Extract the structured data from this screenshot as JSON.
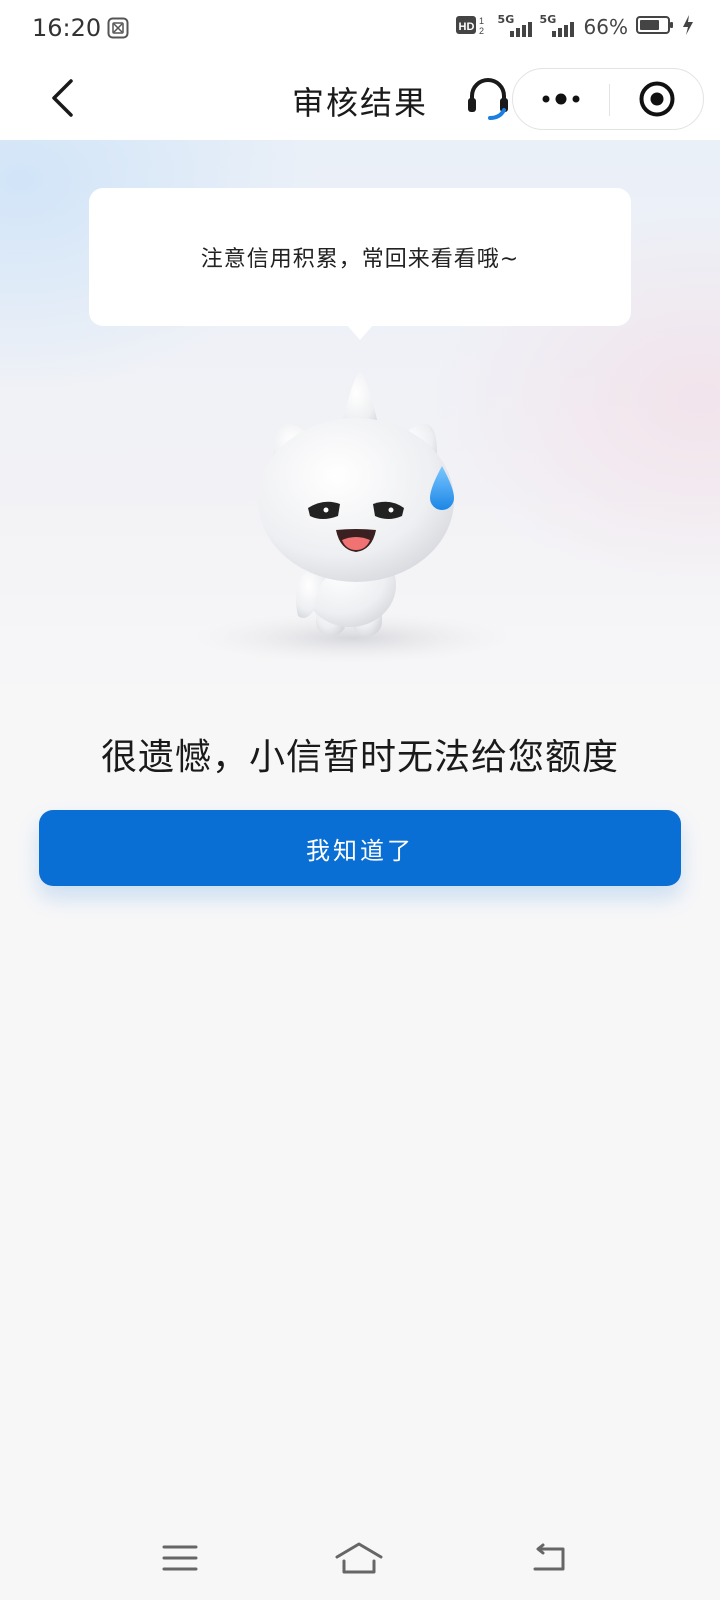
{
  "status_bar": {
    "time": "16:20",
    "battery_percent": "66%",
    "network_1": "5G",
    "network_2": "5G",
    "icons": [
      "screenshot-notification-icon",
      "hd-icon",
      "signal-icon",
      "battery-icon",
      "charging-icon"
    ]
  },
  "nav": {
    "title": "审核结果",
    "icons": [
      "back-icon",
      "headset-icon",
      "more-icon",
      "target-icon"
    ]
  },
  "bubble": {
    "text": "注意信用积累，常回来看看哦~"
  },
  "result": {
    "message": "很遗憾，小信暂时无法给您额度"
  },
  "button": {
    "confirm_label": "我知道了"
  },
  "colors": {
    "accent": "#0a6fd4",
    "background": "#f7f7f8"
  },
  "system_nav": {
    "icons": [
      "menu-icon",
      "home-icon",
      "back-nav-icon"
    ]
  }
}
